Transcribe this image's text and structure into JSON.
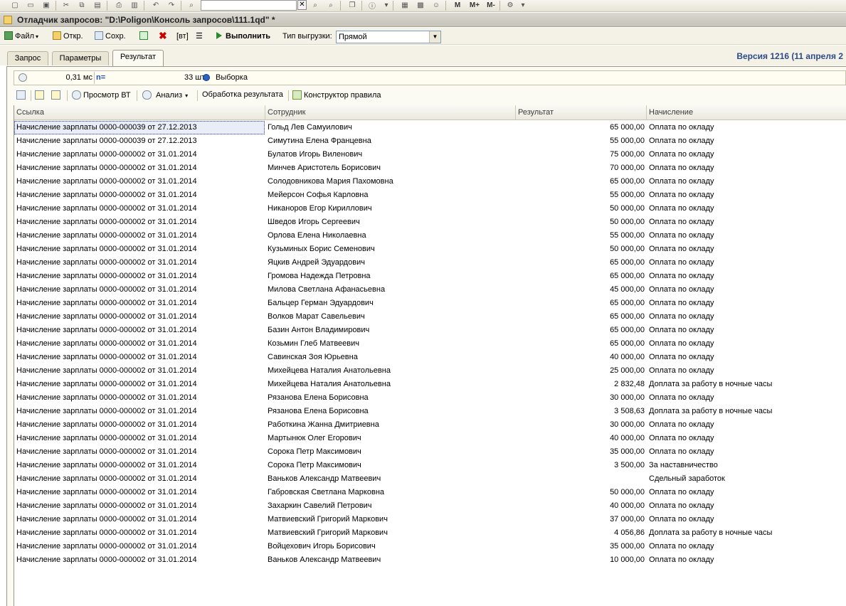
{
  "top_toolbar": {
    "search_value": "",
    "close_label": "✕",
    "m_labels": [
      "M",
      "M+",
      "M-"
    ]
  },
  "window": {
    "title": "Отладчик запросов: \"D:\\Poligon\\Консоль запросов\\111.1qd\" *"
  },
  "form_toolbar": {
    "file_label": "Файл",
    "open_label": "Откр.",
    "save_label": "Сохр.",
    "vt_label": "[вт]",
    "execute_label": "Выполнить",
    "export_type_label": "Тип выгрузки:",
    "export_type_value": "Прямой"
  },
  "tabs": [
    "Запрос",
    "Параметры",
    "Результат"
  ],
  "active_tab": "Результат",
  "version_text": "Версия 1216 (11 апреля 2",
  "status": {
    "time": "0,31 мс",
    "count_label": "n=",
    "count": "33 шт.",
    "selection": "Выборка"
  },
  "result_toolbar": {
    "view_vt_label": "Просмотр ВТ",
    "analysis_label": "Анализ",
    "processing_label": "Обработка результата",
    "rule_builder_label": "Конструктор правила"
  },
  "table": {
    "columns": [
      "Ссылка",
      "Сотрудник",
      "Результат",
      "Начисление"
    ],
    "rows": [
      [
        "Начисление зарплаты 0000-000039 от 27.12.2013",
        "Гольд Лев Самуилович",
        "65 000,00",
        "Оплата по окладу"
      ],
      [
        "Начисление зарплаты 0000-000039 от 27.12.2013",
        "Симутина Елена Францевна",
        "55 000,00",
        "Оплата по окладу"
      ],
      [
        "Начисление зарплаты 0000-000002 от 31.01.2014",
        "Булатов Игорь Виленович",
        "75 000,00",
        "Оплата по окладу"
      ],
      [
        "Начисление зарплаты 0000-000002 от 31.01.2014",
        "Минчев Аристотель Борисович",
        "70 000,00",
        "Оплата по окладу"
      ],
      [
        "Начисление зарплаты 0000-000002 от 31.01.2014",
        "Солодовникова Мария Пахомовна",
        "65 000,00",
        "Оплата по окладу"
      ],
      [
        "Начисление зарплаты 0000-000002 от 31.01.2014",
        "Мейерсон Софья Карловна",
        "55 000,00",
        "Оплата по окладу"
      ],
      [
        "Начисление зарплаты 0000-000002 от 31.01.2014",
        "Никаноров Егор Кириллович",
        "50 000,00",
        "Оплата по окладу"
      ],
      [
        "Начисление зарплаты 0000-000002 от 31.01.2014",
        "Шведов Игорь Сергеевич",
        "50 000,00",
        "Оплата по окладу"
      ],
      [
        "Начисление зарплаты 0000-000002 от 31.01.2014",
        "Орлова Елена Николаевна",
        "55 000,00",
        "Оплата по окладу"
      ],
      [
        "Начисление зарплаты 0000-000002 от 31.01.2014",
        "Кузьминых Борис Семенович",
        "50 000,00",
        "Оплата по окладу"
      ],
      [
        "Начисление зарплаты 0000-000002 от 31.01.2014",
        "Яцкив Андрей Эдуардович",
        "65 000,00",
        "Оплата по окладу"
      ],
      [
        "Начисление зарплаты 0000-000002 от 31.01.2014",
        "Громова Надежда Петровна",
        "65 000,00",
        "Оплата по окладу"
      ],
      [
        "Начисление зарплаты 0000-000002 от 31.01.2014",
        "Милова Светлана Афанасьевна",
        "45 000,00",
        "Оплата по окладу"
      ],
      [
        "Начисление зарплаты 0000-000002 от 31.01.2014",
        "Бальцер Герман Эдуардович",
        "65 000,00",
        "Оплата по окладу"
      ],
      [
        "Начисление зарплаты 0000-000002 от 31.01.2014",
        "Волков Марат Савельевич",
        "65 000,00",
        "Оплата по окладу"
      ],
      [
        "Начисление зарплаты 0000-000002 от 31.01.2014",
        "Базин Антон Владимирович",
        "65 000,00",
        "Оплата по окладу"
      ],
      [
        "Начисление зарплаты 0000-000002 от 31.01.2014",
        "Козьмин Глеб Матвеевич",
        "65 000,00",
        "Оплата по окладу"
      ],
      [
        "Начисление зарплаты 0000-000002 от 31.01.2014",
        "Савинская Зоя Юрьевна",
        "40 000,00",
        "Оплата по окладу"
      ],
      [
        "Начисление зарплаты 0000-000002 от 31.01.2014",
        "Михейцева Наталия Анатольевна",
        "25 000,00",
        "Оплата по окладу"
      ],
      [
        "Начисление зарплаты 0000-000002 от 31.01.2014",
        "Михейцева Наталия Анатольевна",
        "2 832,48",
        "Доплата за работу в ночные часы"
      ],
      [
        "Начисление зарплаты 0000-000002 от 31.01.2014",
        "Рязанова Елена Борисовна",
        "30 000,00",
        "Оплата по окладу"
      ],
      [
        "Начисление зарплаты 0000-000002 от 31.01.2014",
        "Рязанова Елена Борисовна",
        "3 508,63",
        "Доплата за работу в ночные часы"
      ],
      [
        "Начисление зарплаты 0000-000002 от 31.01.2014",
        "Работкина Жанна Дмитриевна",
        "30 000,00",
        "Оплата по окладу"
      ],
      [
        "Начисление зарплаты 0000-000002 от 31.01.2014",
        "Мартынюк Олег Егорович",
        "40 000,00",
        "Оплата по окладу"
      ],
      [
        "Начисление зарплаты 0000-000002 от 31.01.2014",
        "Сорока Петр Максимович",
        "35 000,00",
        "Оплата по окладу"
      ],
      [
        "Начисление зарплаты 0000-000002 от 31.01.2014",
        "Сорока Петр Максимович",
        "3 500,00",
        "За наставничество"
      ],
      [
        "Начисление зарплаты 0000-000002 от 31.01.2014",
        "Ваньков Александр Матвеевич",
        "",
        "Сдельный заработок"
      ],
      [
        "Начисление зарплаты 0000-000002 от 31.01.2014",
        "Габровская Светлана Марковна",
        "50 000,00",
        "Оплата по окладу"
      ],
      [
        "Начисление зарплаты 0000-000002 от 31.01.2014",
        "Захаркин Савелий Петрович",
        "40 000,00",
        "Оплата по окладу"
      ],
      [
        "Начисление зарплаты 0000-000002 от 31.01.2014",
        "Матвиевский Григорий Маркович",
        "37 000,00",
        "Оплата по окладу"
      ],
      [
        "Начисление зарплаты 0000-000002 от 31.01.2014",
        "Матвиевский Григорий Маркович",
        "4 056,86",
        "Доплата за работу в ночные часы"
      ],
      [
        "Начисление зарплаты 0000-000002 от 31.01.2014",
        "Войцехович Игорь Борисович",
        "35 000,00",
        "Оплата по окладу"
      ],
      [
        "Начисление зарплаты 0000-000002 от 31.01.2014",
        "Ваньков Александр Матвеевич",
        "10 000,00",
        "Оплата по окладу"
      ]
    ]
  },
  "colors": {
    "version_text": "#2c4a8a",
    "selection_outline": "#1c3c9c",
    "toolbar_bg": "#f4f2e6"
  }
}
